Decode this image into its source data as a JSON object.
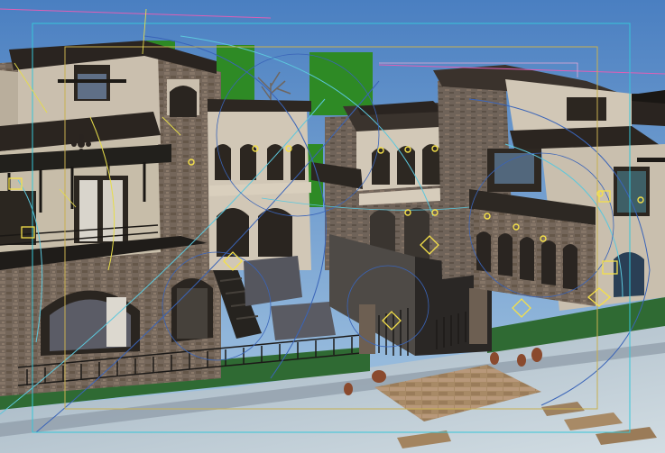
{
  "viewport": {
    "name": "3d-viewport",
    "colors": {
      "sky_top": "#4f86c6",
      "sky_bottom": "#a8c8e2",
      "stone": "#7a6a5e",
      "plaster": "#c9bfae",
      "roof_dark": "#2b2520",
      "lawn": "#2f6b34",
      "plaza": "#b8c6d0",
      "frame_cyan": "#37c6d8",
      "frame_yellow": "#c8b050",
      "light_icon": "#f4e04a",
      "wire_cyan": "#5cc7dc",
      "wire_blue": "#3a64b8",
      "axis_pink": "#e05fb5"
    },
    "icons": [
      "light-helper-icon",
      "camera-helper-icon",
      "vase-object-icon"
    ]
  }
}
